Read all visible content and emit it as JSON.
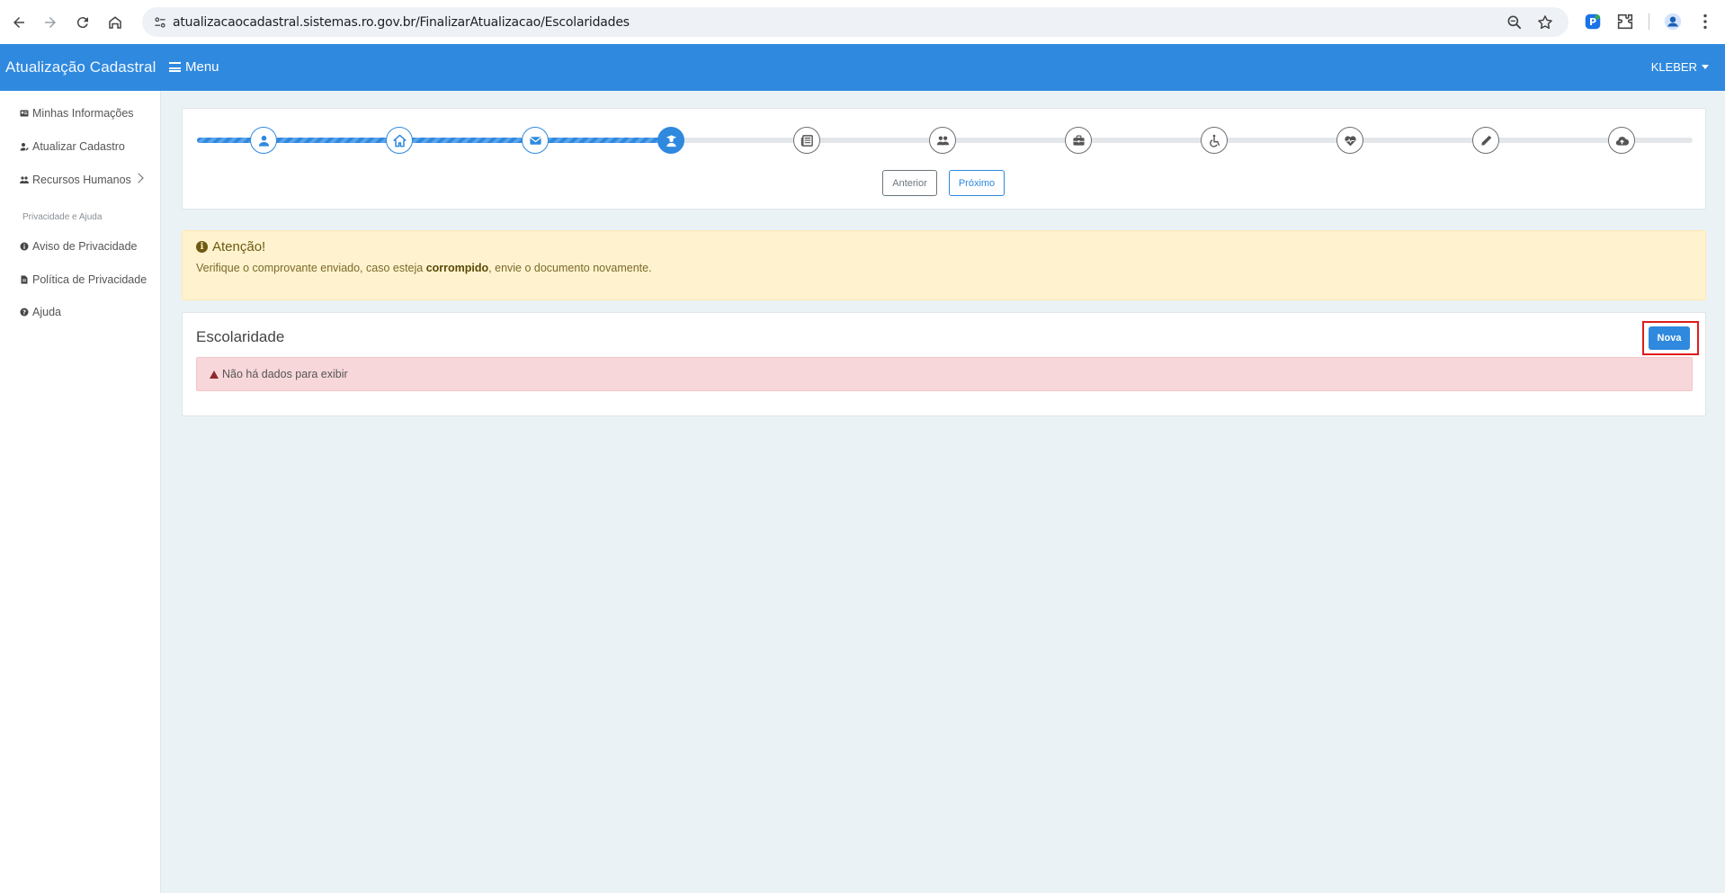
{
  "browser": {
    "url": "atualizacaocadastral.sistemas.ro.gov.br/FinalizarAtualizacao/Escolaridades",
    "icons": [
      "back-icon",
      "forward-icon",
      "reload-icon",
      "home-icon",
      "site-info-icon",
      "zoom-icon",
      "bookmark-star-icon",
      "extension-icon",
      "puzzle-icon",
      "profile-icon",
      "kebab-menu-icon"
    ]
  },
  "header": {
    "brand": "Atualização Cadastral",
    "menu_label": "Menu",
    "user_label": "KLEBER",
    "color": "#2f89de"
  },
  "sidebar": {
    "items": [
      {
        "label": "Minhas Informações",
        "icon": "id-card-icon"
      },
      {
        "label": "Atualizar Cadastro",
        "icon": "user-edit-icon"
      },
      {
        "label": "Recursos Humanos",
        "icon": "users-icon"
      }
    ],
    "section_heading": "Privacidade e Ajuda",
    "help_items": [
      {
        "label": "Aviso de Privacidade",
        "icon": "info-circle-icon"
      },
      {
        "label": "Política de Privacidade",
        "icon": "document-icon"
      },
      {
        "label": "Ajuda",
        "icon": "question-circle-icon"
      }
    ]
  },
  "stepper": {
    "steps": [
      {
        "icon": "user-icon",
        "state": "done"
      },
      {
        "icon": "home-icon",
        "state": "done"
      },
      {
        "icon": "envelope-icon",
        "state": "done"
      },
      {
        "icon": "graduate-icon",
        "state": "current"
      },
      {
        "icon": "newspaper-icon",
        "state": "todo"
      },
      {
        "icon": "users-icon",
        "state": "todo"
      },
      {
        "icon": "briefcase-icon",
        "state": "todo"
      },
      {
        "icon": "wheelchair-icon",
        "state": "todo"
      },
      {
        "icon": "heartbeat-icon",
        "state": "todo"
      },
      {
        "icon": "pen-icon",
        "state": "todo"
      },
      {
        "icon": "cloud-upload-icon",
        "state": "todo"
      }
    ],
    "prev_label": "Anterior",
    "next_label": "Próximo"
  },
  "warning": {
    "title": "Atenção!",
    "text_before": "Verifique o comprovante enviado, caso esteja ",
    "text_bold": "corrompido",
    "text_after": ", envie o documento novamente."
  },
  "escolaridade": {
    "title": "Escolaridade",
    "new_button": "Nova",
    "empty_message": "Não há dados para exibir"
  }
}
